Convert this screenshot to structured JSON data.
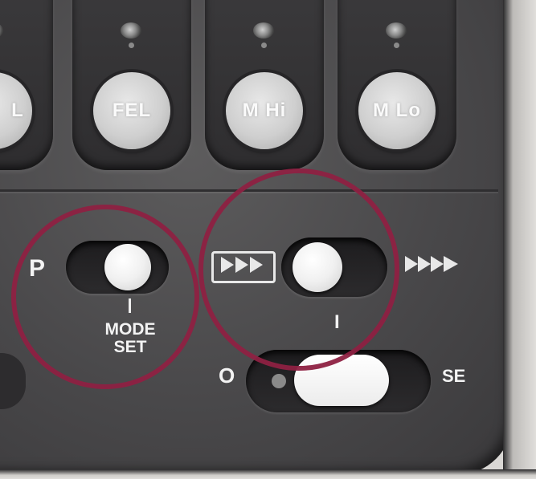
{
  "keys": [
    {
      "label": "L"
    },
    {
      "label": "FEL"
    },
    {
      "label": "M Hi"
    },
    {
      "label": "M Lo"
    }
  ],
  "mode_set": {
    "left_label": "P",
    "label_line1": "MODE",
    "label_line2": "SET"
  },
  "speed_switch": {
    "position_label": "I"
  },
  "power_switch": {
    "left_label": "O",
    "right_label": "SE"
  },
  "colors": {
    "highlight_ring": "#8e2142",
    "panel": "#4a494b",
    "key": "#d8d8d8"
  }
}
